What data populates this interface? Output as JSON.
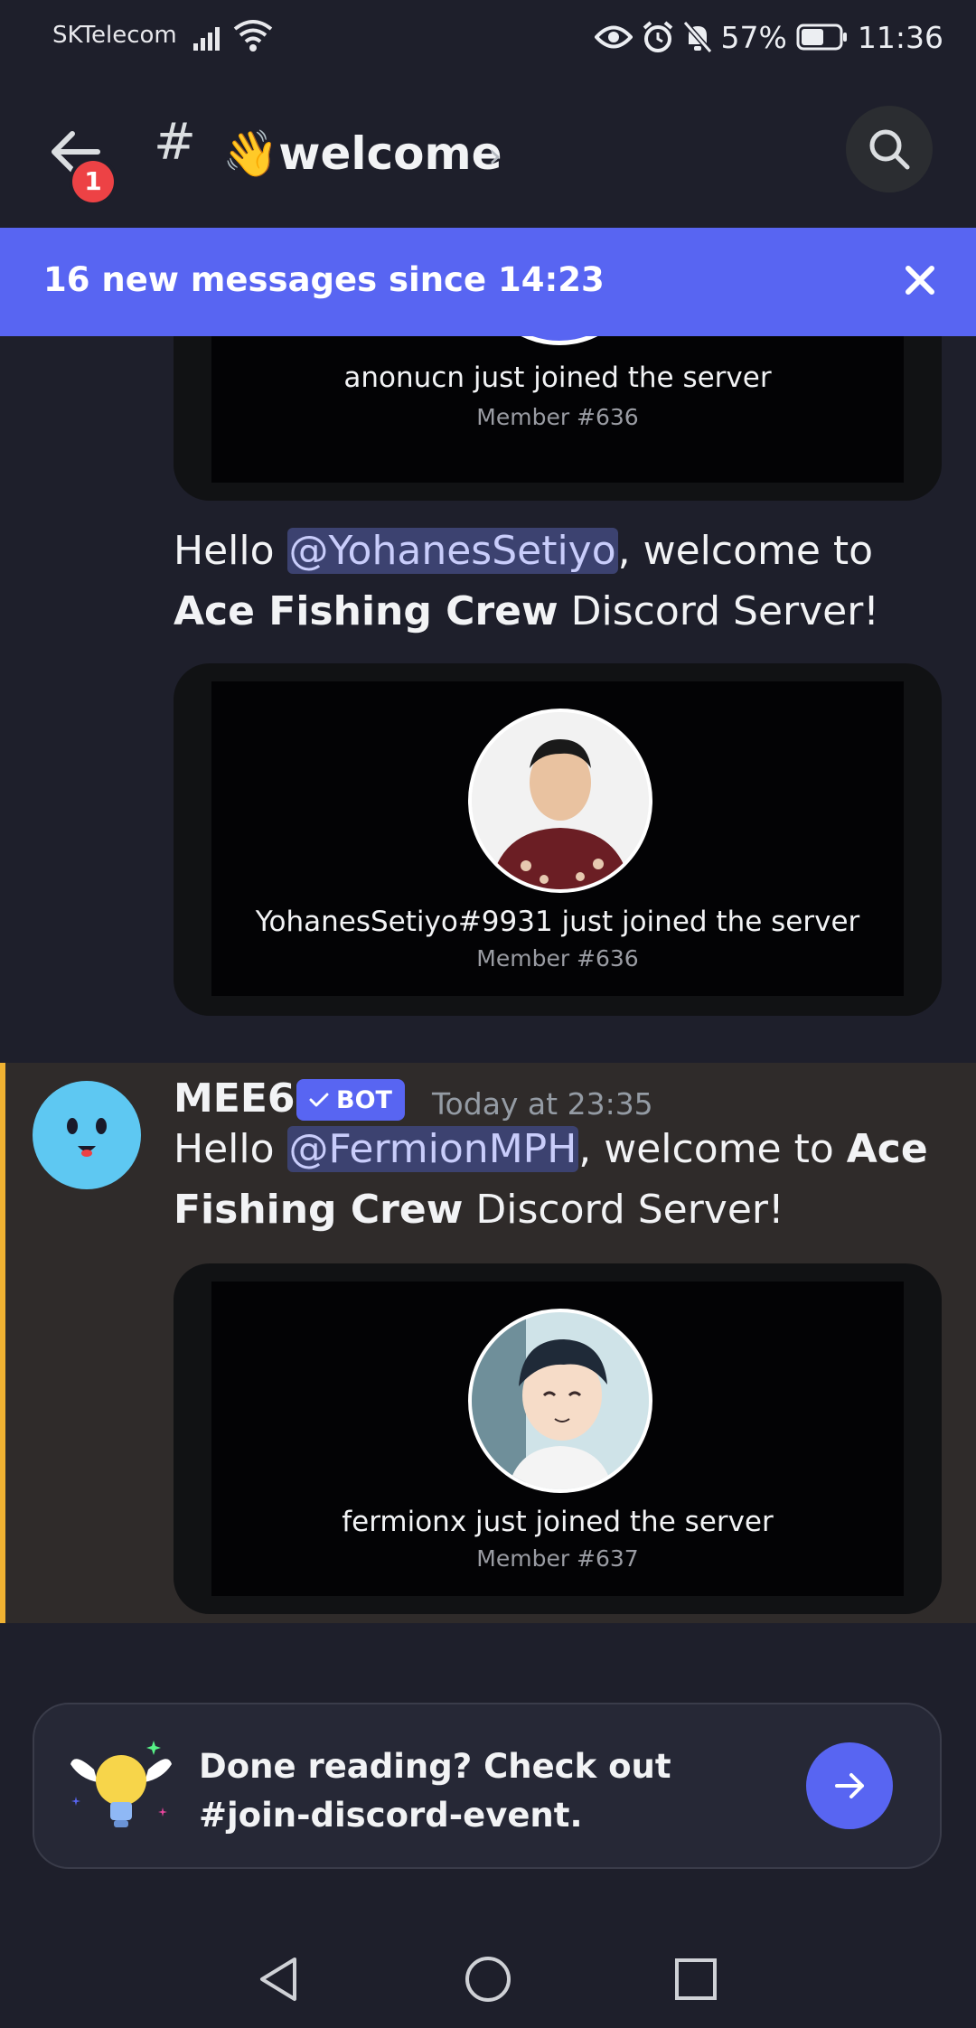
{
  "status_bar": {
    "carrier": "SKTelecom",
    "battery": "57%",
    "time": "11:36"
  },
  "header": {
    "channel_title": "👋welcome",
    "back_badge": "1"
  },
  "banner": {
    "text": "16 new messages since 14:23"
  },
  "messages": [
    {
      "card": {
        "name": "anonucn just joined the server",
        "member": "Member #636"
      }
    },
    {
      "text": {
        "hello": "Hello ",
        "mention": "@YohanesSetiyo",
        "mid": ", welcome to ",
        "server": "Ace Fishing Crew",
        "tail": " Discord Server!"
      },
      "card": {
        "name": "YohanesSetiyo#9931 just joined the server",
        "member": "Member #636"
      }
    },
    {
      "author": "MEE6",
      "bot_tag": "BOT",
      "timestamp": "Today at 23:35",
      "text": {
        "hello": "Hello ",
        "mention": "@FermionMPH",
        "mid": ", welcome to ",
        "server": "Ace Fishing Crew",
        "tail": " Discord Server!"
      },
      "card": {
        "name": "fermionx just joined the server",
        "member": "Member #637"
      }
    }
  ],
  "cta": {
    "text": "Done reading? Check out #join-discord-event."
  },
  "colors": {
    "accent": "#5865f2",
    "highlight_bar": "#f0b232",
    "mention_bg": "#3c4270"
  }
}
